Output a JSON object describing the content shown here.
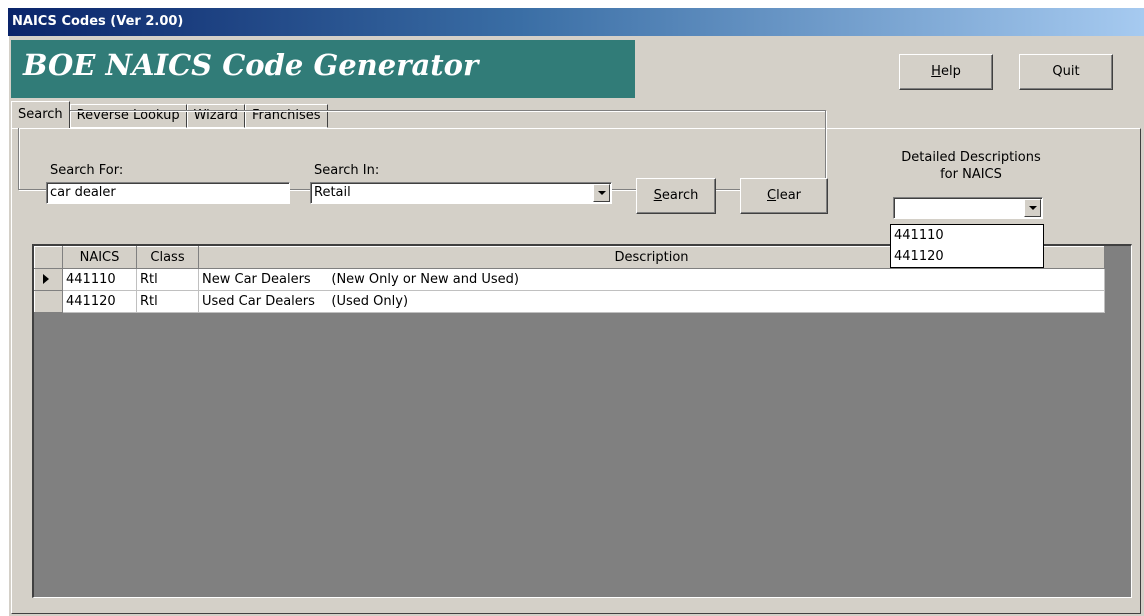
{
  "window": {
    "title": "NAICS Codes (Ver 2.00)"
  },
  "banner": {
    "title": "BOE NAICS Code Generator"
  },
  "toolbar": {
    "help_label": "Help",
    "help_key": "H",
    "help_rest": "elp",
    "quit_label": "Quit"
  },
  "tabs": [
    {
      "label": "Search",
      "active": true
    },
    {
      "label": "Reverse Lookup",
      "active": false
    },
    {
      "label": "Wizard",
      "active": false
    },
    {
      "label": "Franchises",
      "active": false
    }
  ],
  "search": {
    "search_for_label": "Search For:",
    "search_for_value": "car dealer",
    "search_in_label": "Search In:",
    "search_in_value": "Retail",
    "search_button": "Search",
    "search_key": "S",
    "search_rest": "earch",
    "clear_button": "Clear",
    "clear_key": "C",
    "clear_rest": "lear"
  },
  "detail": {
    "label_line1": "Detailed Descriptions",
    "label_line2": "for NAICS",
    "selected": "",
    "options": [
      "441110",
      "441120"
    ]
  },
  "grid": {
    "columns": [
      "NAICS",
      "Class",
      "Description"
    ],
    "rows": [
      {
        "naics": "441110",
        "class": "Rtl",
        "description": "New Car Dealers     (New Only or New and Used)",
        "current": true
      },
      {
        "naics": "441120",
        "class": "Rtl",
        "description": "Used Car Dealers    (Used Only)",
        "current": false
      }
    ]
  },
  "colors": {
    "banner": "#317c78",
    "titlebar_start": "#0a246a",
    "titlebar_end": "#a6caf0",
    "face": "#d4d0c8",
    "grid_bg": "#808080"
  }
}
